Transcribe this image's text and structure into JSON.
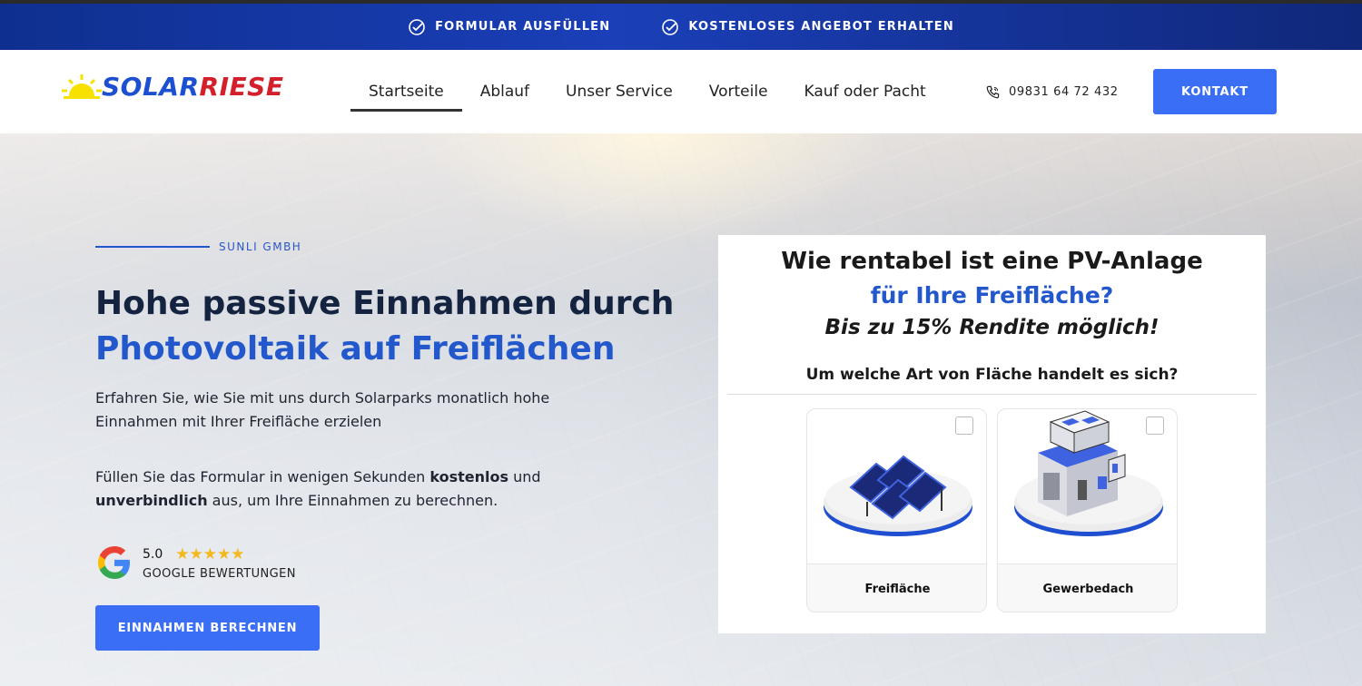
{
  "topbar": {
    "items": [
      {
        "label": "FORMULAR AUSFÜLLEN",
        "icon": "check-badge-icon"
      },
      {
        "label": "KOSTENLOSES ANGEBOT ERHALTEN",
        "icon": "check-badge-icon"
      }
    ]
  },
  "header": {
    "logo": {
      "part1": "SOLAR",
      "part2": "RIESE"
    },
    "nav": [
      "Startseite",
      "Ablauf",
      "Unser Service",
      "Vorteile",
      "Kauf oder Pacht"
    ],
    "active_nav": "Startseite",
    "phone": "09831 64 72 432",
    "contact_label": "KONTAKT"
  },
  "hero": {
    "eyebrow": "SUNLI GMBH",
    "title_line1": "Hohe passive Einnahmen durch",
    "title_line2": "Photovoltaik auf Freiflächen",
    "para1": "Erfahren Sie, wie Sie mit uns durch Solarparks monatlich hohe Einnahmen mit Ihrer Freifläche erzielen",
    "para2": {
      "a": "Füllen Sie das Formular in wenigen Sekunden ",
      "b": "kostenlos",
      "c": " und ",
      "d": "unverbindlich",
      "e": " aus, um Ihre Einnahmen zu berechnen."
    },
    "rating": {
      "score": "5.0",
      "stars": "★★★★★",
      "label": "GOOGLE BEWERTUNGEN"
    },
    "cta_label": "EINNAHMEN BERECHNEN"
  },
  "form": {
    "q1": "Wie rentabel ist eine PV-Anlage",
    "q2": "für Ihre Freifläche?",
    "q3": "Bis zu 15% Rendite möglich!",
    "question": "Um welche Art von Fläche handelt es sich?",
    "options": [
      {
        "label": "Freifläche",
        "icon": "solar-field-icon"
      },
      {
        "label": "Gewerbedach",
        "icon": "commercial-building-icon"
      }
    ]
  },
  "colors": {
    "primary": "#3a6ff5",
    "brand_blue": "#2357cc",
    "brand_red": "#d3202a",
    "topbar": "#1a3fb8"
  }
}
